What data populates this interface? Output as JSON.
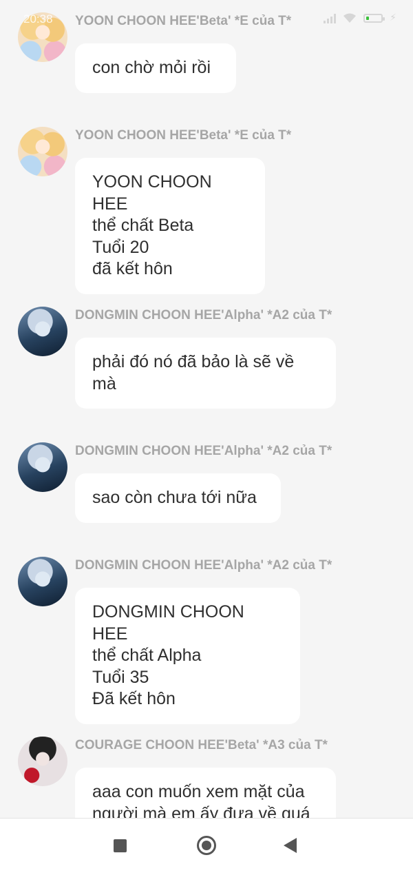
{
  "status_bar": {
    "time": "20:38"
  },
  "messages": [
    {
      "sender": "YOON CHOON HEE'Beta' *E của T*",
      "avatar": "beta-girl-avatar",
      "text": "con chờ mỏi rồi"
    },
    {
      "sender": "YOON CHOON HEE'Beta' *E của T*",
      "avatar": "beta-girl-avatar",
      "text": "YOON CHOON HEE\nthể chất Beta\nTuổi 20\nđã kết hôn"
    },
    {
      "sender": "DONGMIN CHOON HEE'Alpha' *A2 của T*",
      "avatar": "alpha-boy-avatar",
      "text": "phải đó nó đã bảo là sẽ về\nmà"
    },
    {
      "sender": "DONGMIN CHOON HEE'Alpha' *A2 của T*",
      "avatar": "alpha-boy-avatar",
      "text": "sao còn chưa tới nữa"
    },
    {
      "sender": "DONGMIN CHOON HEE'Alpha' *A2 của T*",
      "avatar": "alpha-boy-avatar",
      "text": "DONGMIN CHOON HEE\nthể chất Alpha\nTuổi 35\nĐã kết hôn"
    },
    {
      "sender": "COURAGE CHOON HEE'Beta' *A3 của T*",
      "avatar": "courage-avatar",
      "text": "aaa con muốn xem mặt của\nngười mà em ấy đưa về quá"
    }
  ],
  "nav_bar": {
    "recents": "square-icon",
    "home": "circle-icon",
    "back": "triangle-back-icon"
  }
}
